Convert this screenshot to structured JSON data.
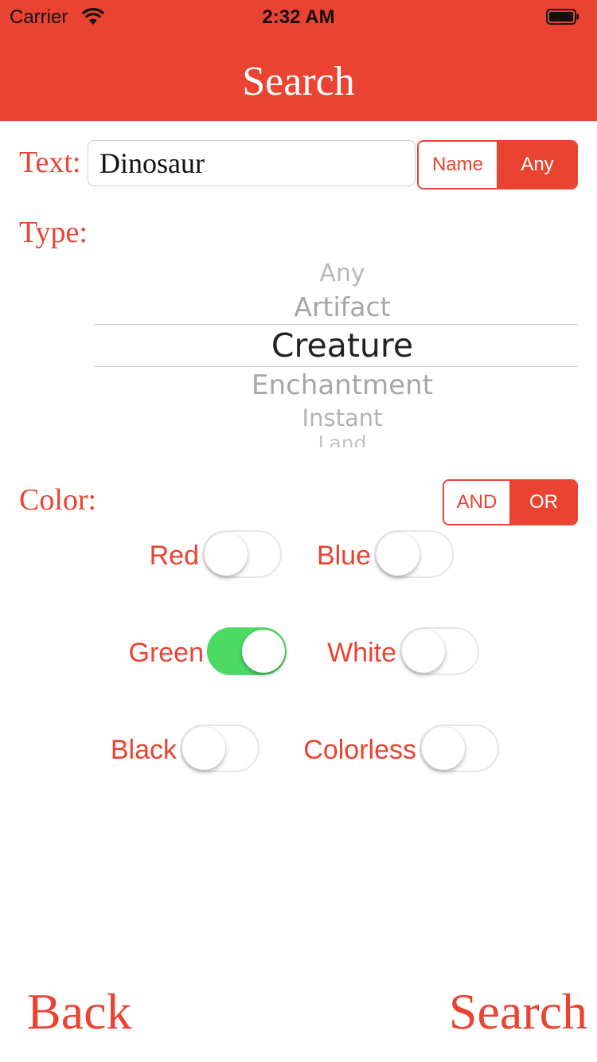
{
  "status_bar": {
    "carrier": "Carrier",
    "time": "2:32 AM"
  },
  "nav": {
    "title": "Search"
  },
  "text_search": {
    "label": "Text:",
    "value": "Dinosaur",
    "mode_options": [
      "Name",
      "Any"
    ],
    "selected_mode": "Any"
  },
  "type": {
    "label": "Type:",
    "options": [
      "Any",
      "Artifact",
      "Creature",
      "Enchantment",
      "Instant",
      "Land"
    ],
    "selected": "Creature"
  },
  "color": {
    "label": "Color:",
    "logic_options": [
      "AND",
      "OR"
    ],
    "selected_logic": "OR",
    "toggles": [
      {
        "label": "Red",
        "on": false
      },
      {
        "label": "Blue",
        "on": false
      },
      {
        "label": "Green",
        "on": true
      },
      {
        "label": "White",
        "on": false
      },
      {
        "label": "Black",
        "on": false
      },
      {
        "label": "Colorless",
        "on": false
      }
    ]
  },
  "actions": {
    "back": "Back",
    "search": "Search"
  },
  "colors": {
    "accent": "#ea4331",
    "switch_on": "#4cd964"
  }
}
